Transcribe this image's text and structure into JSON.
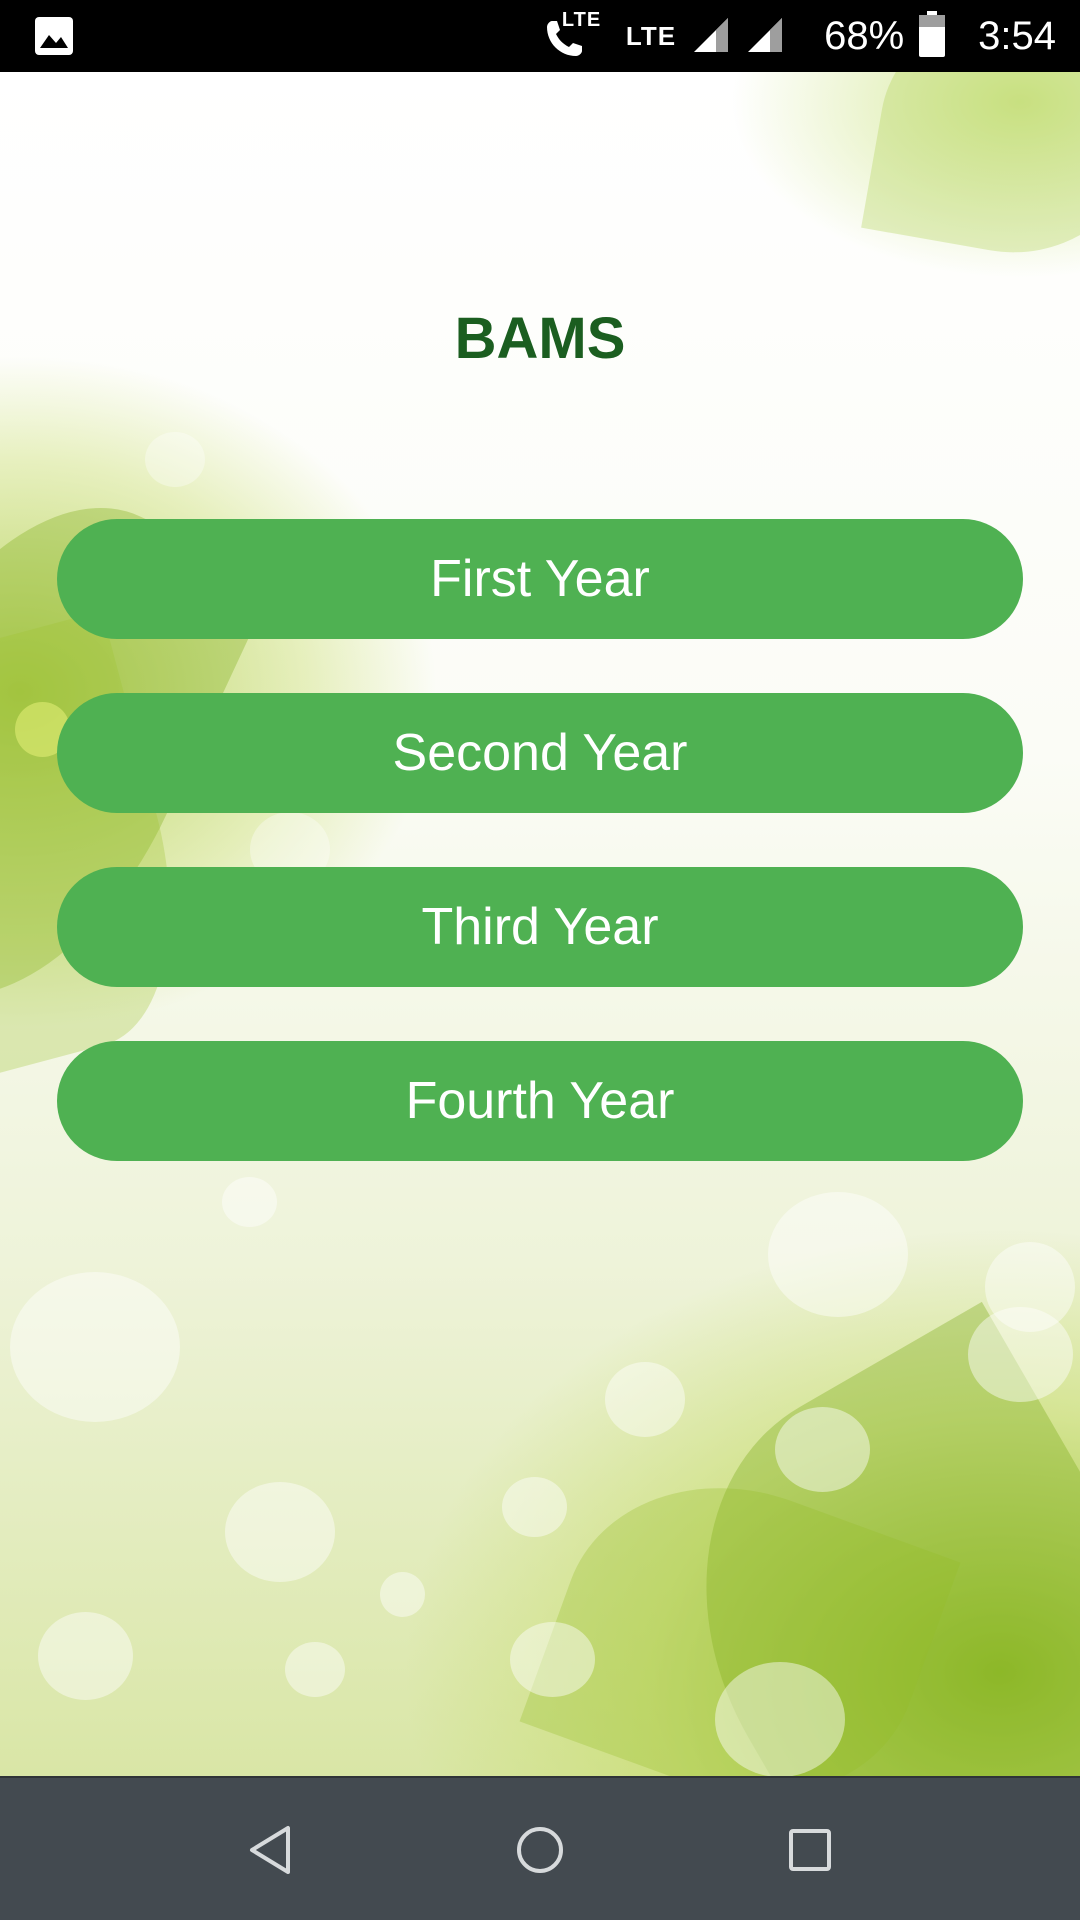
{
  "status_bar": {
    "icons": [
      "gallery-icon",
      "volte-call-icon",
      "signal-icon",
      "signal-icon",
      "battery-icon"
    ],
    "lte_call_label": "LTE",
    "lte_label": "LTE",
    "battery_percent": "68%",
    "time": "3:54"
  },
  "main": {
    "title": "BAMS",
    "buttons": [
      {
        "label": "First Year"
      },
      {
        "label": "Second Year"
      },
      {
        "label": "Third Year"
      },
      {
        "label": "Fourth Year"
      }
    ],
    "colors": {
      "title": "#1b5e20",
      "button_bg": "#4fb152",
      "button_text": "#ffffff"
    }
  },
  "nav_bar": {
    "icons": [
      "back-icon",
      "home-icon",
      "recents-icon"
    ]
  }
}
